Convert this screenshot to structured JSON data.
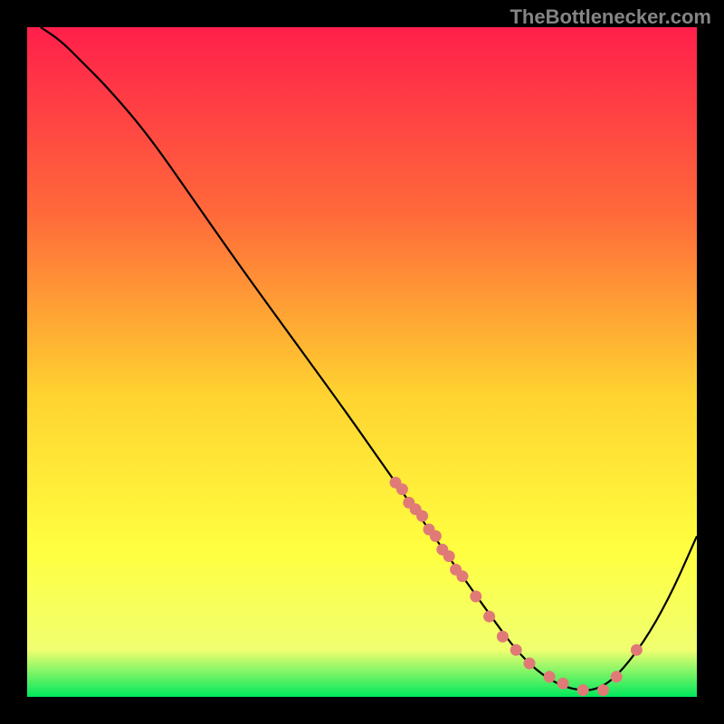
{
  "attribution": "TheBottlenecker.com",
  "colors": {
    "background": "#000000",
    "curve": "#000000",
    "dots": "#e07a77",
    "gradient_top": "#ff1f4b",
    "gradient_mid1": "#ff6a3a",
    "gradient_mid2": "#ffd330",
    "gradient_mid3": "#ffff40",
    "gradient_mid4": "#f0ff70",
    "gradient_bottom": "#00e85c"
  },
  "chart_data": {
    "type": "line",
    "title": "",
    "xlabel": "",
    "ylabel": "",
    "xlim": [
      0,
      100
    ],
    "ylim": [
      0,
      100
    ],
    "series": [
      {
        "name": "bottleneck-curve",
        "x": [
          2,
          5,
          8,
          12,
          18,
          25,
          32,
          40,
          48,
          55,
          60,
          65,
          70,
          73,
          76,
          79,
          82,
          85,
          88,
          92,
          96,
          100
        ],
        "y": [
          100,
          98,
          95,
          91,
          84,
          74,
          64,
          53,
          42,
          32,
          25,
          18,
          11,
          7,
          4,
          2,
          1,
          1,
          3,
          8,
          15,
          24
        ]
      }
    ],
    "scatter_points": {
      "name": "highlight-dots",
      "x": [
        55,
        56,
        57,
        58,
        59,
        60,
        61,
        62,
        63,
        64,
        65,
        67,
        69,
        71,
        73,
        75,
        78,
        80,
        83,
        86,
        88,
        91
      ],
      "y": [
        32,
        31,
        29,
        28,
        27,
        25,
        24,
        22,
        21,
        19,
        18,
        15,
        12,
        9,
        7,
        5,
        3,
        2,
        1,
        1,
        3,
        7
      ]
    }
  }
}
